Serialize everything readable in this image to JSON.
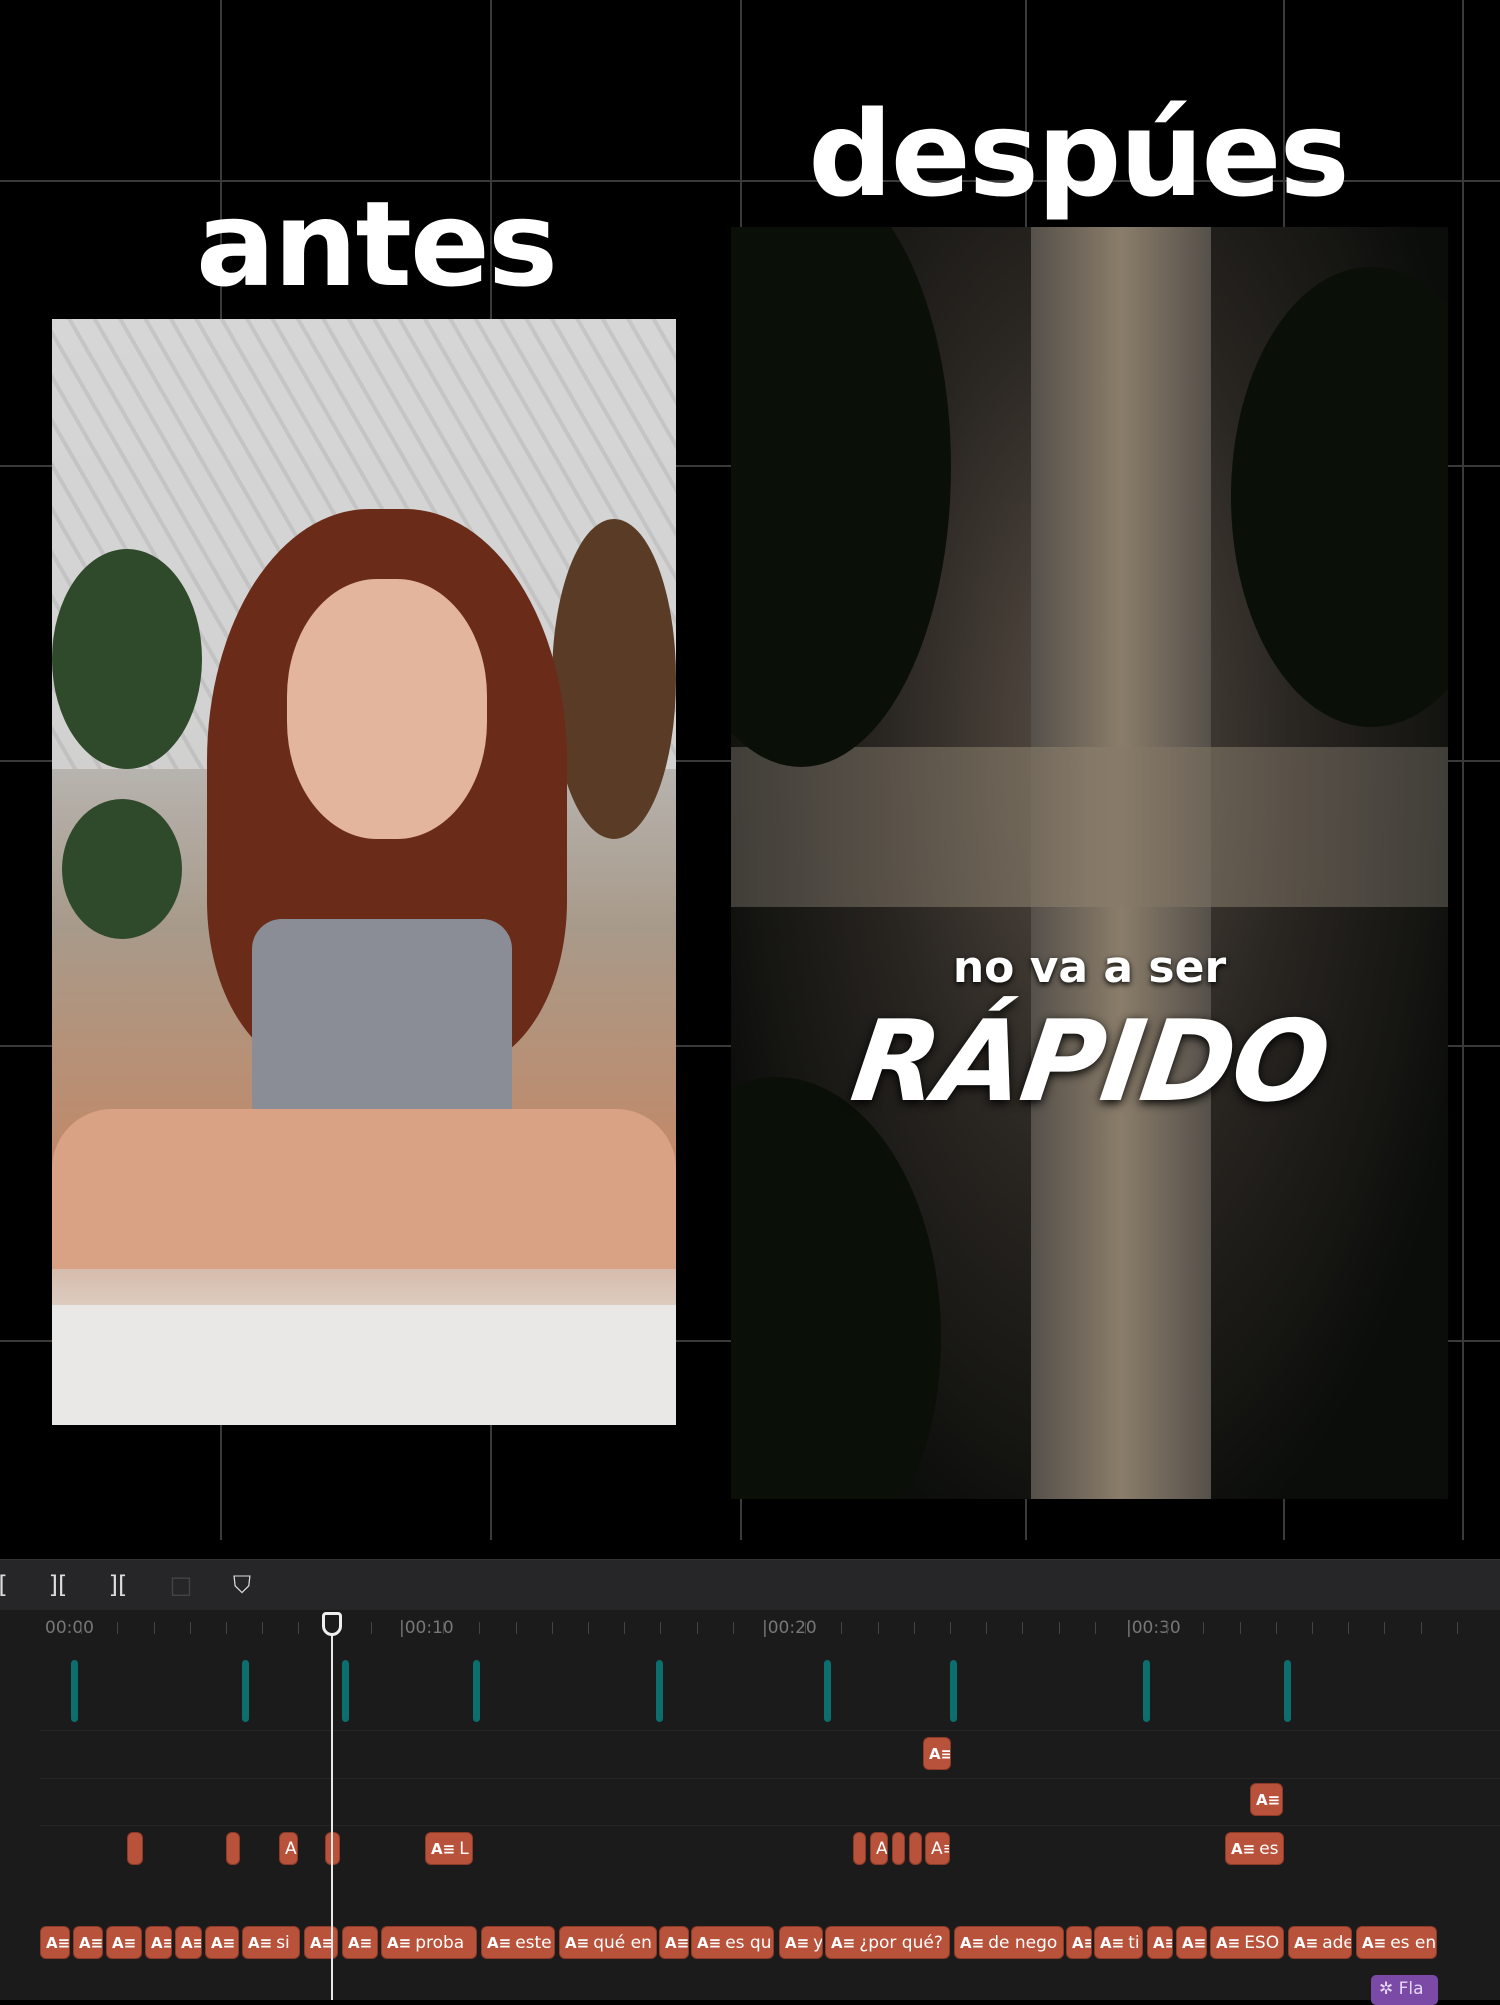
{
  "headings": {
    "before": "antes",
    "after": "despúes"
  },
  "right_video": {
    "caption_small": "no va a ser",
    "caption_big": "RÁPIDO"
  },
  "toolbar": {
    "icons": [
      "trim-start-icon",
      "split-left-icon",
      "split-right-icon",
      "delete-icon",
      "marker-icon"
    ]
  },
  "timeline": {
    "ruler": [
      "00:00",
      "|00:10",
      "|00:20",
      "|00:30"
    ],
    "clip_icon": "A≡",
    "row_text_5": [
      "",
      "",
      "",
      "",
      "",
      "",
      "si",
      "",
      "",
      "proba",
      "este",
      "qué en",
      "",
      "es qu",
      "y",
      "¿por qué?",
      "de nego",
      "",
      "ti",
      "",
      "",
      "ESO",
      "ade",
      "es en"
    ],
    "row_text_4": [
      "",
      "",
      "A",
      "",
      "L",
      "",
      "A",
      "",
      "",
      "A≡",
      "es"
    ],
    "fx_clip": "✲ Fla"
  },
  "colors": {
    "text_clip": "#b9523a",
    "marker": "#0d6e6e",
    "effect_clip": "#7a4aa6"
  }
}
